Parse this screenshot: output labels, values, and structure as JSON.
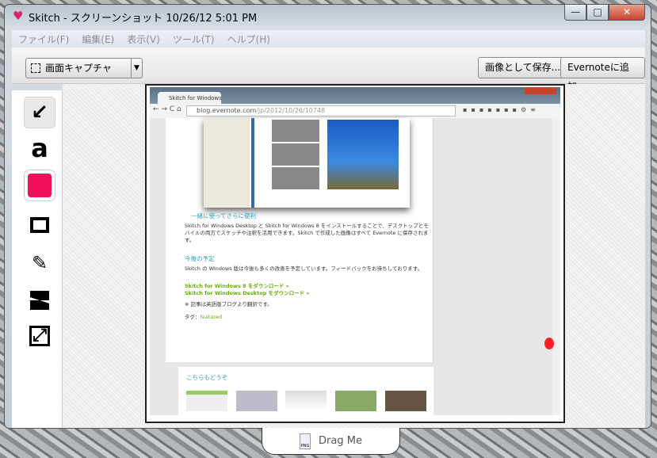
{
  "window": {
    "title": "Skitch - スクリーンショット 10/26/12 5:01 PM",
    "controls": [
      "—",
      "□",
      "✕"
    ]
  },
  "menu": [
    "ファイル(F)",
    "編集(E)",
    "表示(V)",
    "ツール(T)",
    "ヘルプ(H)"
  ],
  "toolbar": {
    "capture_label": "画面キャプチャ",
    "save_label": "画像として保存...",
    "evernote_label": "Evernoteに追加"
  },
  "tools": {
    "color": "#f0115a"
  },
  "screenshot": {
    "tab_title": "Skitch for Windows Desk",
    "url_host": "blog.evernote.com",
    "url_path": "/jp/2012/10/26/10748",
    "section1_heading": "一緒に使ってさらに便利",
    "section1_body": "Skitch for Windows Desktop と Skitch for Windows 8 をインストールすることで、デスクトップとモバイルの両方でスケッチや注釈を活用できます。Skitch で作成した画像はすべて Evernote に保存されます。",
    "section2_heading": "今後の予定",
    "section2_body": "Skitch の Windows 版は今後も多くの改善を予定しています。フィードバックをお待ちしております。",
    "link1": "Skitch for Windows 8 をダウンロード »",
    "link2": "Skitch for Windows Desktop をダウンロード »",
    "note": "※ 記事は英語版ブログより翻訳です。",
    "tags_label": "タグ：",
    "tag": "featured",
    "related_heading": "こちらもどうぞ"
  },
  "drag": {
    "label": "Drag Me",
    "file_type": "PNG"
  }
}
